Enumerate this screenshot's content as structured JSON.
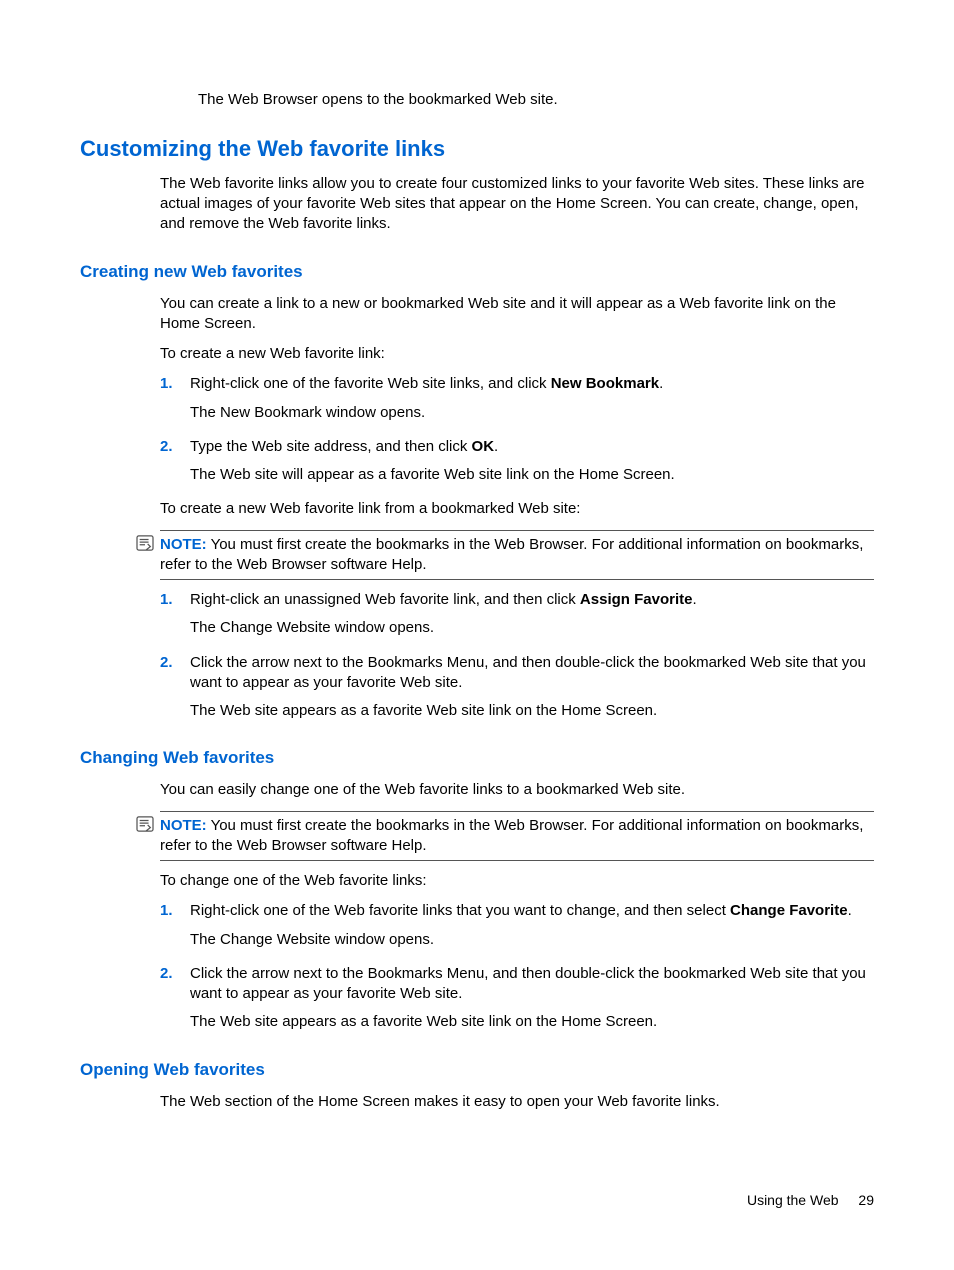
{
  "intro_result": "The Web Browser opens to the bookmarked Web site.",
  "h1": "Customizing the Web favorite links",
  "h1_para": "The Web favorite links allow you to create four customized links to your favorite Web sites. These links are actual images of your favorite Web sites that appear on the Home Screen. You can create, change, open, and remove the Web favorite links.",
  "sec_create": {
    "title": "Creating new Web favorites",
    "p1": "You can create a link to a new or bookmarked Web site and it will appear as a Web favorite link on the Home Screen.",
    "p2": "To create a new Web favorite link:",
    "step1_pre": "Right-click one of the favorite Web site links, and click ",
    "step1_bold": "New Bookmark",
    "step1_post": ".",
    "step1_result": "The New Bookmark window opens.",
    "step2_pre": "Type the Web site address, and then click ",
    "step2_bold": "OK",
    "step2_post": ".",
    "step2_result": "The Web site will appear as a favorite Web site link on the Home Screen.",
    "p3": "To create a new Web favorite link from a bookmarked Web site:",
    "note_label": "NOTE:",
    "note_text": "You must first create the bookmarks in the Web Browser. For additional information on bookmarks, refer to the Web Browser software Help.",
    "stepB1_pre": "Right-click an unassigned Web favorite link, and then click ",
    "stepB1_bold": "Assign Favorite",
    "stepB1_post": ".",
    "stepB1_result": "The Change Website window opens.",
    "stepB2": "Click the arrow next to the Bookmarks Menu, and then double-click the bookmarked Web site that you want to appear as your favorite Web site.",
    "stepB2_result": "The Web site appears as a favorite Web site link on the Home Screen."
  },
  "sec_change": {
    "title": "Changing Web favorites",
    "p1": "You can easily change one of the Web favorite links to a bookmarked Web site.",
    "note_label": "NOTE:",
    "note_text": "You must first create the bookmarks in the Web Browser. For additional information on bookmarks, refer to the Web Browser software Help.",
    "p2": "To change one of the Web favorite links:",
    "step1_pre": "Right-click one of the Web favorite links that you want to change, and then select ",
    "step1_bold": "Change Favorite",
    "step1_post": ".",
    "step1_result": "The Change Website window opens.",
    "step2": "Click the arrow next to the Bookmarks Menu, and then double-click the bookmarked Web site that you want to appear as your favorite Web site.",
    "step2_result": "The Web site appears as a favorite Web site link on the Home Screen."
  },
  "sec_open": {
    "title": "Opening Web favorites",
    "p1": "The Web section of the Home Screen makes it easy to open your Web favorite links."
  },
  "footer": {
    "section": "Using the Web",
    "page": "29"
  },
  "numbers": {
    "n1": "1.",
    "n2": "2."
  }
}
